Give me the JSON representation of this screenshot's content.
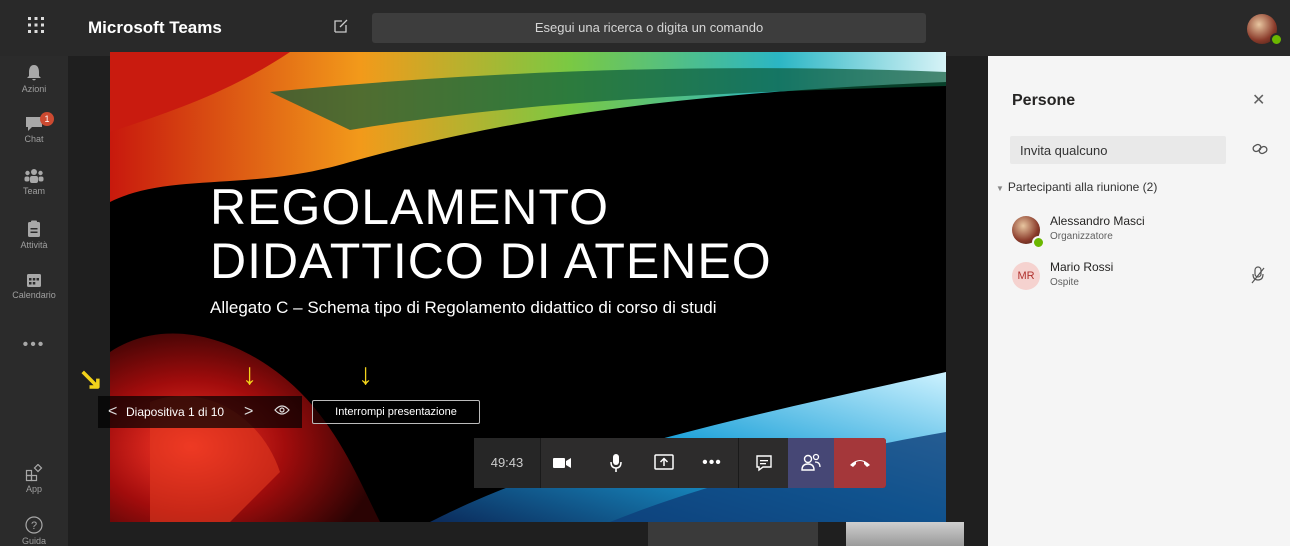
{
  "app": {
    "title": "Microsoft Teams",
    "search_placeholder": "Esegui una ricerca o digita un comando"
  },
  "rail": [
    {
      "id": "activity",
      "label": "Azioni",
      "icon": "bell-icon"
    },
    {
      "id": "chat",
      "label": "Chat",
      "icon": "chat-icon",
      "badge": "1"
    },
    {
      "id": "teams",
      "label": "Team",
      "icon": "teams-icon"
    },
    {
      "id": "assignments",
      "label": "Attività",
      "icon": "assignments-icon"
    },
    {
      "id": "calendar",
      "label": "Calendario",
      "icon": "calendar-icon"
    },
    {
      "id": "more",
      "label": "",
      "icon": "more-icon"
    },
    {
      "id": "apps",
      "label": "App",
      "icon": "apps-icon"
    },
    {
      "id": "help",
      "label": "Guida",
      "icon": "help-icon"
    }
  ],
  "slide": {
    "title": "REGOLAMENTO\nDIDATTICO DI ATENEO",
    "subtitle": "Allegato C – Schema tipo di Regolamento didattico di corso di studi"
  },
  "slide_nav": {
    "counter": "Diapositiva 1 di 10",
    "stop_label": "Interrompi presentazione"
  },
  "call_controls": {
    "timer": "49:43"
  },
  "people_panel": {
    "title": "Persone",
    "invite_placeholder": "Invita qualcuno",
    "group_label": "Partecipanti alla riunione (2)",
    "participants": [
      {
        "name": "Alessandro Masci",
        "role": "Organizzatore",
        "initials": ""
      },
      {
        "name": "Mario Rossi",
        "role": "Ospite",
        "initials": "MR"
      }
    ]
  },
  "colors": {
    "accent": "#464775",
    "hangup": "#a4373a",
    "annotation": "#f2d21b",
    "presence": "#6bb700"
  }
}
